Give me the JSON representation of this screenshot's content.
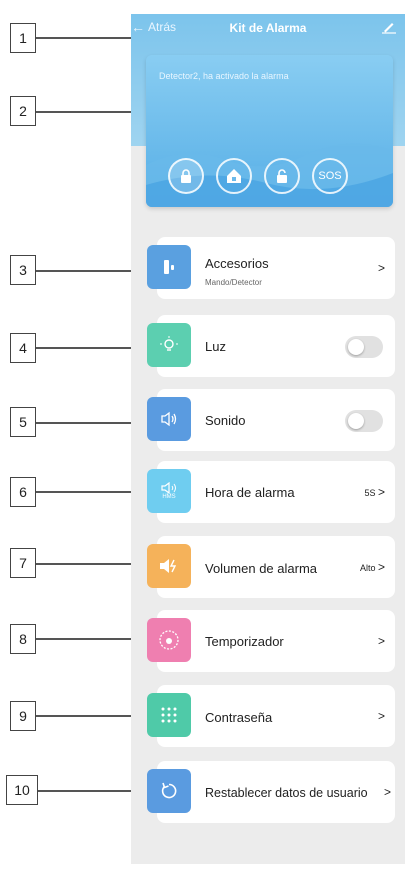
{
  "header": {
    "back_label": "Atrás",
    "title": "Kit de Alarma",
    "edit_icon": "edit-pencil-icon"
  },
  "alarm_card": {
    "message": "Detector2, ha activado la alarma",
    "modes": [
      {
        "name": "arm-lock-icon",
        "active": true
      },
      {
        "name": "home-arm-icon",
        "active": false
      },
      {
        "name": "disarm-unlock-icon",
        "active": false
      },
      {
        "name": "SOS",
        "active": false
      }
    ],
    "sos_label": "SOS"
  },
  "menu": {
    "accessories": {
      "label": "Accesorios",
      "sub": "Mando/Detector",
      "chev": ">"
    },
    "light": {
      "label": "Luz",
      "enabled": false
    },
    "sound": {
      "label": "Sonido",
      "enabled": false
    },
    "alarm_time": {
      "label": "Hora de alarma",
      "value": "5S",
      "chev": ">",
      "icon_text": "HMS"
    },
    "alarm_volume": {
      "label": "Volumen de alarma",
      "value": "Alto",
      "chev": ">"
    },
    "timer": {
      "label": "Temporizador",
      "chev": ">"
    },
    "password": {
      "label": "Contraseña",
      "chev": ">"
    },
    "reset": {
      "label": "Restablecer datos de usuario",
      "chev": ">"
    }
  },
  "callouts": [
    "1",
    "2",
    "3",
    "4",
    "5",
    "6",
    "7",
    "8",
    "9",
    "10"
  ],
  "colors": {
    "accessories": "#5aa0e0",
    "light": "#5ccfb0",
    "sound": "#5a9be0",
    "alarm_time": "#6fcdf0",
    "alarm_volume": "#f5b25a",
    "timer": "#ef7fb0",
    "password": "#4fcaa8",
    "reset": "#5a9be0"
  }
}
